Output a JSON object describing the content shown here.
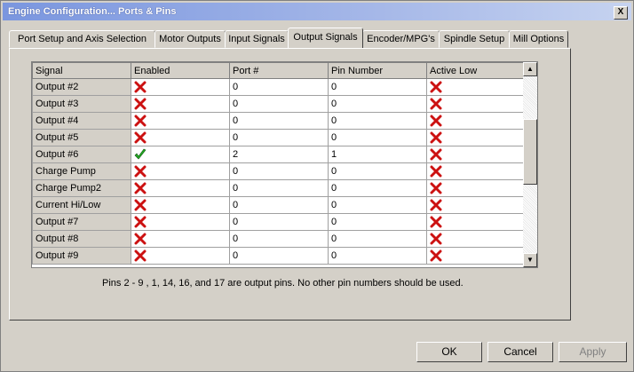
{
  "window": {
    "title": "Engine Configuration... Ports & Pins",
    "close_glyph": "X"
  },
  "tabs": [
    {
      "label": "Port Setup and Axis Selection"
    },
    {
      "label": "Motor Outputs"
    },
    {
      "label": "Input Signals"
    },
    {
      "label": "Output Signals",
      "active": true
    },
    {
      "label": "Encoder/MPG's"
    },
    {
      "label": "Spindle Setup"
    },
    {
      "label": "Mill Options"
    }
  ],
  "grid": {
    "columns": [
      "Signal",
      "Enabled",
      "Port #",
      "Pin Number",
      "Active Low"
    ],
    "rows": [
      {
        "signal": "Output #2",
        "enabled": false,
        "port": "0",
        "pin": "0",
        "active_low": false
      },
      {
        "signal": "Output #3",
        "enabled": false,
        "port": "0",
        "pin": "0",
        "active_low": false
      },
      {
        "signal": "Output #4",
        "enabled": false,
        "port": "0",
        "pin": "0",
        "active_low": false
      },
      {
        "signal": "Output #5",
        "enabled": false,
        "port": "0",
        "pin": "0",
        "active_low": false
      },
      {
        "signal": "Output #6",
        "enabled": true,
        "port": "2",
        "pin": "1",
        "active_low": false
      },
      {
        "signal": "Charge Pump",
        "enabled": false,
        "port": "0",
        "pin": "0",
        "active_low": false
      },
      {
        "signal": "Charge Pump2",
        "enabled": false,
        "port": "0",
        "pin": "0",
        "active_low": false
      },
      {
        "signal": "Current Hi/Low",
        "enabled": false,
        "port": "0",
        "pin": "0",
        "active_low": false
      },
      {
        "signal": "Output #7",
        "enabled": false,
        "port": "0",
        "pin": "0",
        "active_low": false
      },
      {
        "signal": "Output #8",
        "enabled": false,
        "port": "0",
        "pin": "0",
        "active_low": false
      },
      {
        "signal": "Output #9",
        "enabled": false,
        "port": "0",
        "pin": "0",
        "active_low": false
      }
    ]
  },
  "info_text": "Pins 2 - 9 , 1, 14, 16, and 17 are output pins. No  other pin numbers should be used.",
  "buttons": {
    "ok": "OK",
    "cancel": "Cancel",
    "apply": "Apply"
  },
  "colors": {
    "check": "#22aa22",
    "cross": "#cc1111"
  }
}
